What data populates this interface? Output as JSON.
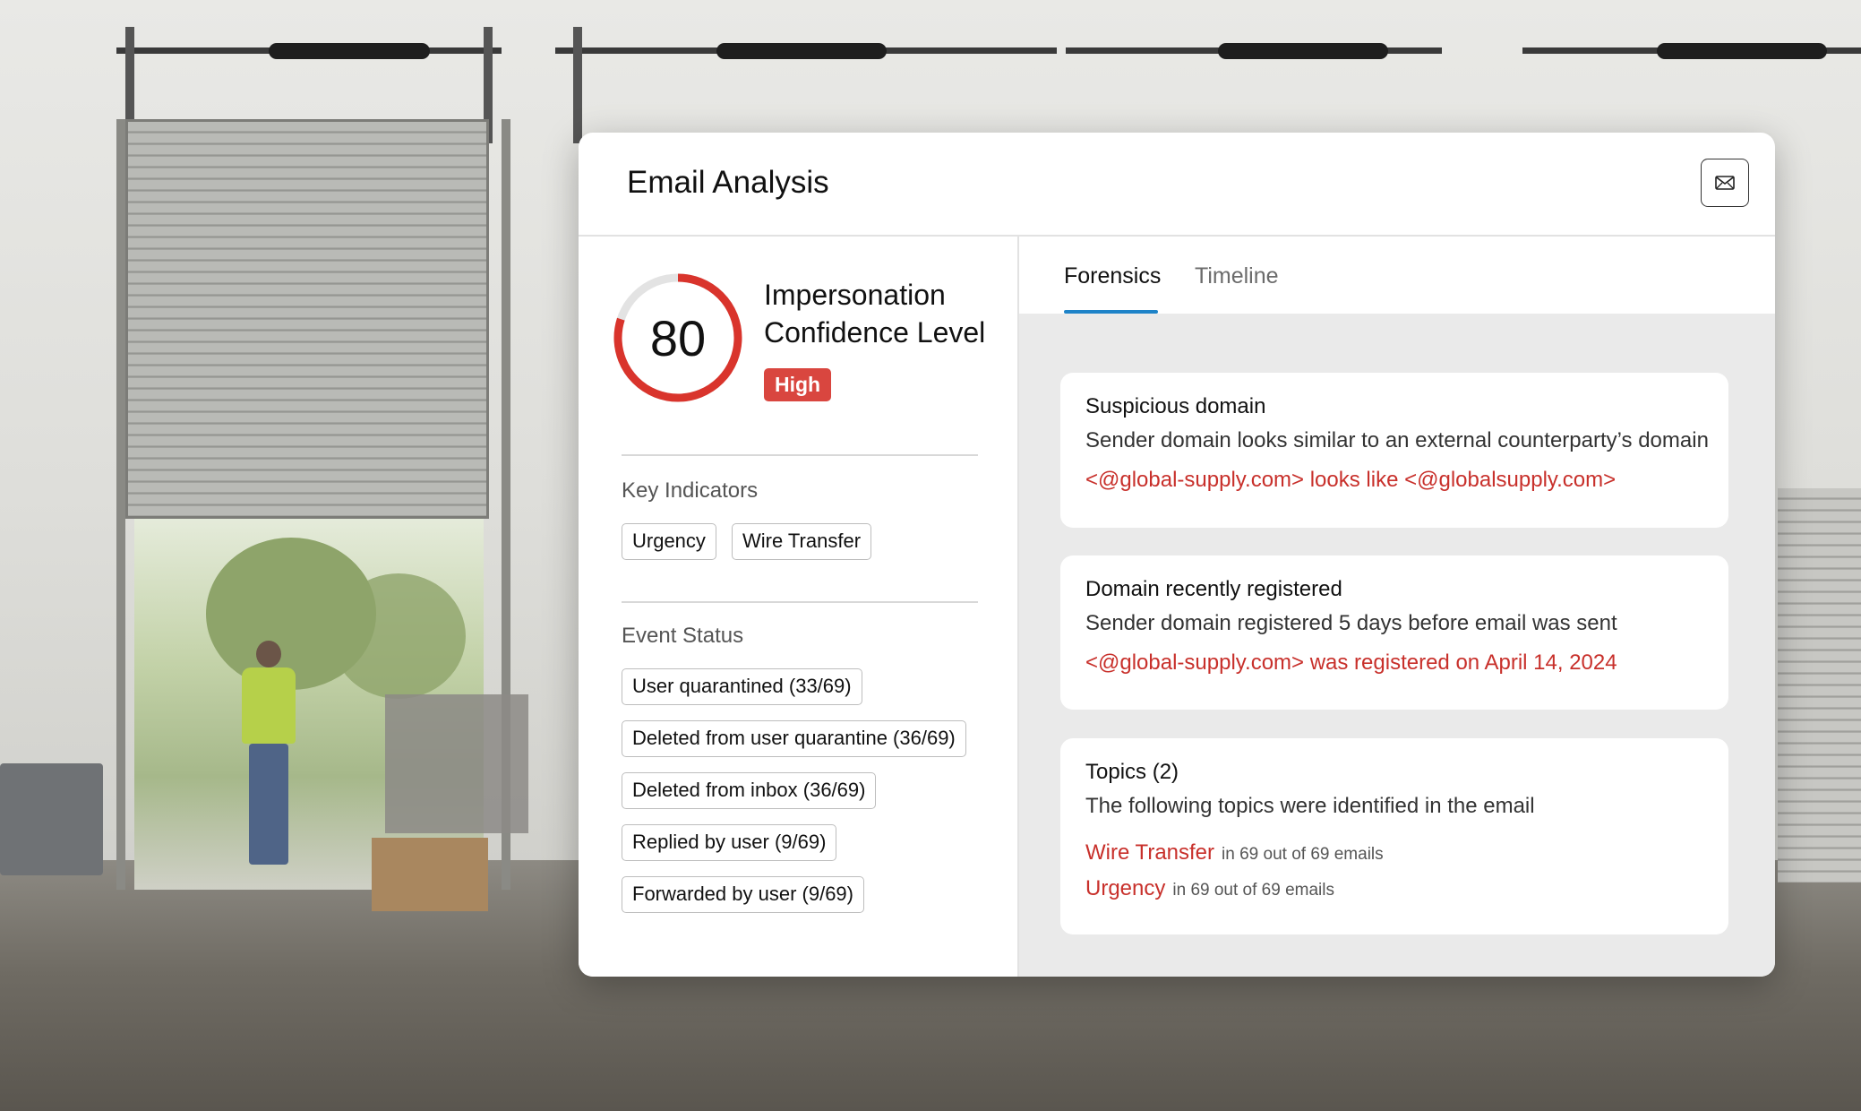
{
  "card": {
    "title": "Email Analysis",
    "mail_icon": "envelope-icon"
  },
  "score": {
    "value": "80",
    "fraction": 0.8,
    "title": "Impersonation Confidence Level",
    "level": "High",
    "colors": {
      "arc": "#d9342c",
      "track": "#e3e3e3",
      "badge": "#d9463f"
    }
  },
  "key_indicators": {
    "label": "Key Indicators",
    "items": [
      "Urgency",
      "Wire Transfer"
    ]
  },
  "event_status": {
    "label": "Event Status",
    "items": [
      "User quarantined (33/69)",
      "Deleted from user quarantine (36/69)",
      "Deleted from inbox (36/69)",
      "Replied by user (9/69)",
      "Forwarded by user (9/69)"
    ]
  },
  "tabs": {
    "active": "Forensics",
    "inactive": "Timeline",
    "accent": "#1e83c8"
  },
  "findings": [
    {
      "title": "Suspicious domain",
      "description": "Sender domain looks similar to an external counterparty’s domain",
      "detail": "<@global-supply.com> looks like <@globalsupply.com>"
    },
    {
      "title": "Domain recently registered",
      "description": "Sender domain registered 5 days before email was sent",
      "detail": "<@global-supply.com> was registered on April 14, 2024"
    }
  ],
  "topics": {
    "title": "Topics (2)",
    "description": "The following topics were identified in the email",
    "items": [
      {
        "name": "Wire Transfer",
        "count": "in 69 out of 69 emails"
      },
      {
        "name": "Urgency",
        "count": "in 69 out of 69 emails"
      }
    ]
  }
}
